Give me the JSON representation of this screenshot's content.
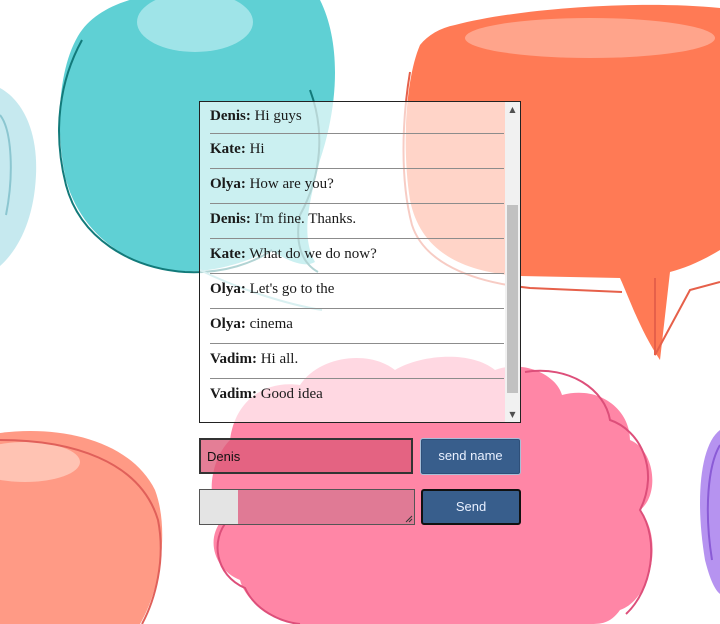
{
  "chat": {
    "messages": [
      {
        "author": "Denis:",
        "text": " Hi guys"
      },
      {
        "author": "Kate:",
        "text": " Hi"
      },
      {
        "author": "Olya:",
        "text": " How are you?"
      },
      {
        "author": "Denis:",
        "text": " I'm fine. Thanks."
      },
      {
        "author": "Kate:",
        "text": " What do we do now?"
      },
      {
        "author": "Olya:",
        "text": " Let's go to the"
      },
      {
        "author": "Olya:",
        "text": " cinema"
      },
      {
        "author": "Vadim:",
        "text": " Hi all."
      },
      {
        "author": "Vadim:",
        "text": " Good idea"
      }
    ]
  },
  "form": {
    "name_value": "Denis",
    "send_name_label": "send name",
    "message_value": "",
    "send_label": "Send"
  },
  "icons": {
    "scroll_up": "scroll-up-arrow-icon",
    "scroll_down": "scroll-down-arrow-icon",
    "resize": "resize-grip-icon"
  },
  "colors": {
    "button_bg": "#385e8c",
    "button_text": "#e8f0ff",
    "bubble_teal": "#5fd0d4",
    "bubble_orange": "#ff7a55",
    "bubble_pink": "#ff86a6",
    "bubble_salmon": "#ff9a85"
  }
}
